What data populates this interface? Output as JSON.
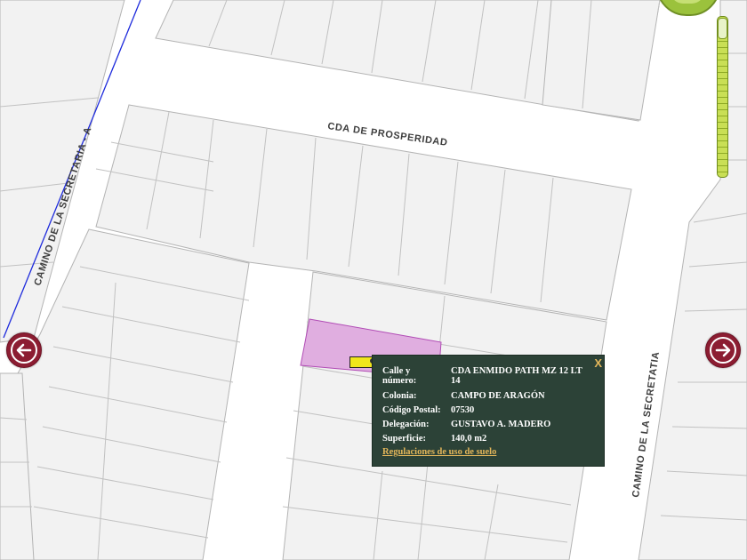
{
  "map": {
    "streets": {
      "cda_prosperidad": "CDA DE PROSPERIDAD",
      "secretaria_a": "CAMINO DE LA SECRETARIA - A",
      "secretatia": "CAMINO DE LA SECRETATIA"
    },
    "highlight_color": "#e0aee0",
    "block_fill": "#f2f2f2",
    "block_stroke": "#b4b4b4"
  },
  "navigation": {
    "left_icon": "arrow-left-icon",
    "right_icon": "arrow-right-icon",
    "button_color": "#8c1d32"
  },
  "zoom": {
    "control_color": "#9bc23c",
    "level": 0.0
  },
  "marker": {
    "color": "#f0e61c"
  },
  "popup": {
    "close_label": "X",
    "rows": [
      {
        "label": "Calle y número:",
        "value": "CDA ENMIDO PATH MZ 12 LT 14"
      },
      {
        "label": "Colonia:",
        "value": "CAMPO DE ARAGÓN"
      },
      {
        "label": "Código Postal:",
        "value": "07530"
      },
      {
        "label": "Delegación:",
        "value": "GUSTAVO A. MADERO"
      },
      {
        "label": "Superficie:",
        "value": "140,0 m2"
      }
    ],
    "link": "Regulaciones de uso de suelo",
    "background": "#2c4237",
    "link_color": "#e3b65a"
  }
}
